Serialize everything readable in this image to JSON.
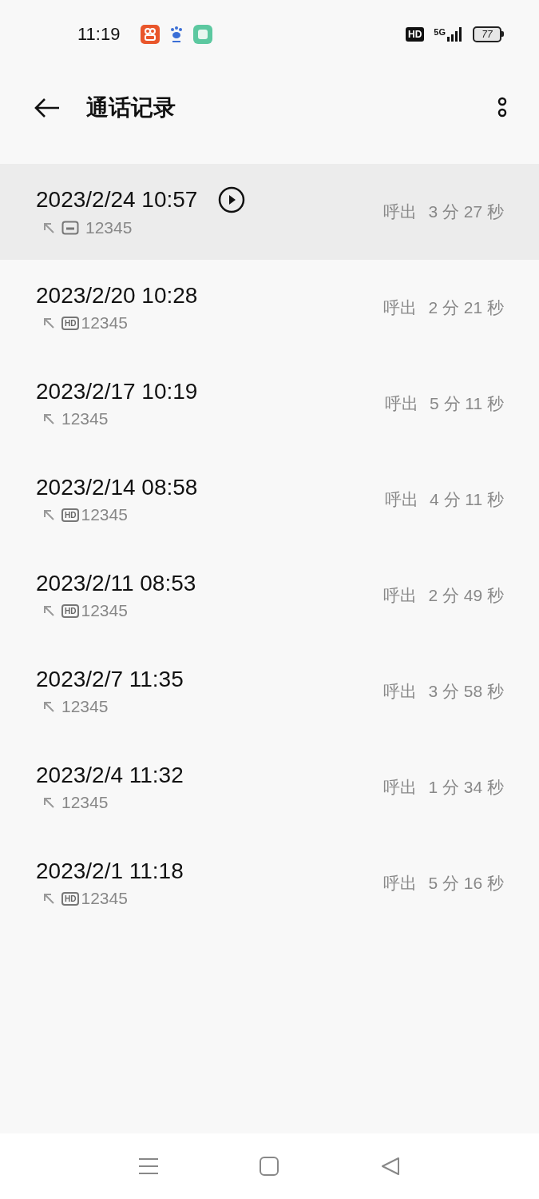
{
  "status_bar": {
    "time": "11:19",
    "hd": "HD",
    "network": "5G",
    "battery": "77"
  },
  "header": {
    "title": "通话记录"
  },
  "calls": [
    {
      "datetime": "2023/2/24 10:57",
      "selected": true,
      "recorded": true,
      "number": "12345",
      "type": "呼出",
      "duration": "3 分 27 秒"
    },
    {
      "datetime": "2023/2/20 10:28",
      "selected": false,
      "recorded": false,
      "tag": "HD",
      "number": "12345",
      "type": "呼出",
      "duration": "2 分 21 秒"
    },
    {
      "datetime": "2023/2/17 10:19",
      "selected": false,
      "recorded": false,
      "number": "12345",
      "type": "呼出",
      "duration": "5 分 11 秒"
    },
    {
      "datetime": "2023/2/14 08:58",
      "selected": false,
      "recorded": false,
      "tag": "HD",
      "number": "12345",
      "type": "呼出",
      "duration": "4 分 11 秒"
    },
    {
      "datetime": "2023/2/11 08:53",
      "selected": false,
      "recorded": false,
      "tag": "HD",
      "number": "12345",
      "type": "呼出",
      "duration": "2 分 49 秒"
    },
    {
      "datetime": "2023/2/7 11:35",
      "selected": false,
      "recorded": false,
      "number": "12345",
      "type": "呼出",
      "duration": "3 分 58 秒"
    },
    {
      "datetime": "2023/2/4 11:32",
      "selected": false,
      "recorded": false,
      "number": "12345",
      "type": "呼出",
      "duration": "1 分 34 秒"
    },
    {
      "datetime": "2023/2/1 11:18",
      "selected": false,
      "recorded": false,
      "tag": "HD",
      "number": "12345",
      "type": "呼出",
      "duration": "5 分 16 秒"
    }
  ]
}
